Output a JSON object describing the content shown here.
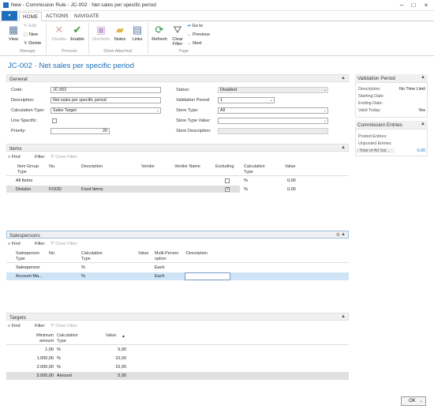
{
  "window": {
    "title": "New - Commission Rule - JC-002 · Net sales per specific period"
  },
  "ribbon_tabs": [
    "HOME",
    "ACTIONS",
    "NAVIGATE"
  ],
  "ribbon": {
    "view": "View",
    "edit": "Edit",
    "new": "New",
    "delete": "Delete",
    "disable": "Disable",
    "enable": "Enable",
    "onenote": "OneNote",
    "notes": "Notes",
    "links": "Links",
    "refresh": "Refresh",
    "clear_filter_1": "Clear",
    "clear_filter_2": "Filter",
    "goto": "Go to",
    "previous": "Previous",
    "next": "Next",
    "groups": [
      "Manage",
      "Process",
      "Show Attached",
      "Page"
    ]
  },
  "page_title": "JC-002 · Net sales per specific period",
  "general": {
    "header": "General",
    "code_label": "Code:",
    "code": "JC-002",
    "description_label": "Description:",
    "description": "Net sales per specific period",
    "calc_type_label": "Calculation Type:",
    "calc_type": "Sales Target",
    "line_specific_label": "Line Specific:",
    "priority_label": "Priority:",
    "priority": "20",
    "status_label": "Status:",
    "status": "Disabled",
    "validation_period_label": "Validation Period:",
    "validation_period": "1",
    "store_type_label": "Store Type:",
    "store_type": "All",
    "store_type_value_label": "Store Type Value:",
    "store_type_value": "",
    "store_description_label": "Store Description:",
    "store_description": ""
  },
  "toolbar": {
    "find": "Find",
    "filter": "Filter",
    "clear_filter": "Clear Filter"
  },
  "items": {
    "header": "Items",
    "columns": [
      "Item Group Type",
      "No.",
      "Description",
      "Vendor",
      "Vendor Name",
      "Excluding",
      "Calculation Type",
      "Value"
    ],
    "rows": [
      {
        "type": "All Items",
        "no": "",
        "desc": "",
        "excluding": false,
        "calc": "%",
        "value": "0,00"
      },
      {
        "type": "Division",
        "no": "FOOD",
        "desc": "Food Items",
        "excluding": true,
        "calc": "%",
        "value": "0,00"
      }
    ]
  },
  "salespersons": {
    "header": "Salespersons",
    "columns": [
      "Salesperson Type",
      "No.",
      "Calculation Type",
      "Value",
      "Multi-Person option",
      "Description"
    ],
    "rows": [
      {
        "type": "Salesperson",
        "calc": "%",
        "multi": "Each"
      },
      {
        "type": "Account Ma...",
        "calc": "%",
        "multi": "Each"
      }
    ]
  },
  "targets": {
    "header": "Targets",
    "columns": [
      "Minimum amount",
      "Calculation Type",
      "Value"
    ],
    "rows": [
      {
        "min": "1,00",
        "calc": "%",
        "value": "5,00"
      },
      {
        "min": "1.000,00",
        "calc": "%",
        "value": "10,00"
      },
      {
        "min": "2.000,00",
        "calc": "%",
        "value": "15,00"
      },
      {
        "min": "5.000,00",
        "calc": "Amount",
        "value": "5,00"
      }
    ]
  },
  "factbox_validation": {
    "header": "Validation Period",
    "description_label": "Description:",
    "description": "No Time Limit",
    "starting_date_label": "Starting Date:",
    "ending_date_label": "Ending Date:",
    "valid_today_label": "Valid Today:",
    "valid_today": "Yes"
  },
  "factbox_commission": {
    "header": "Commission Entries",
    "posted_label": "Posted Entries:",
    "unposted_label": "Unposted Entries:",
    "total_label": "Total of All Sal...",
    "total": "0,00"
  },
  "ok_button": "OK",
  "colors": {
    "accent": "#1e6ebb",
    "title": "#1f6fb6"
  }
}
